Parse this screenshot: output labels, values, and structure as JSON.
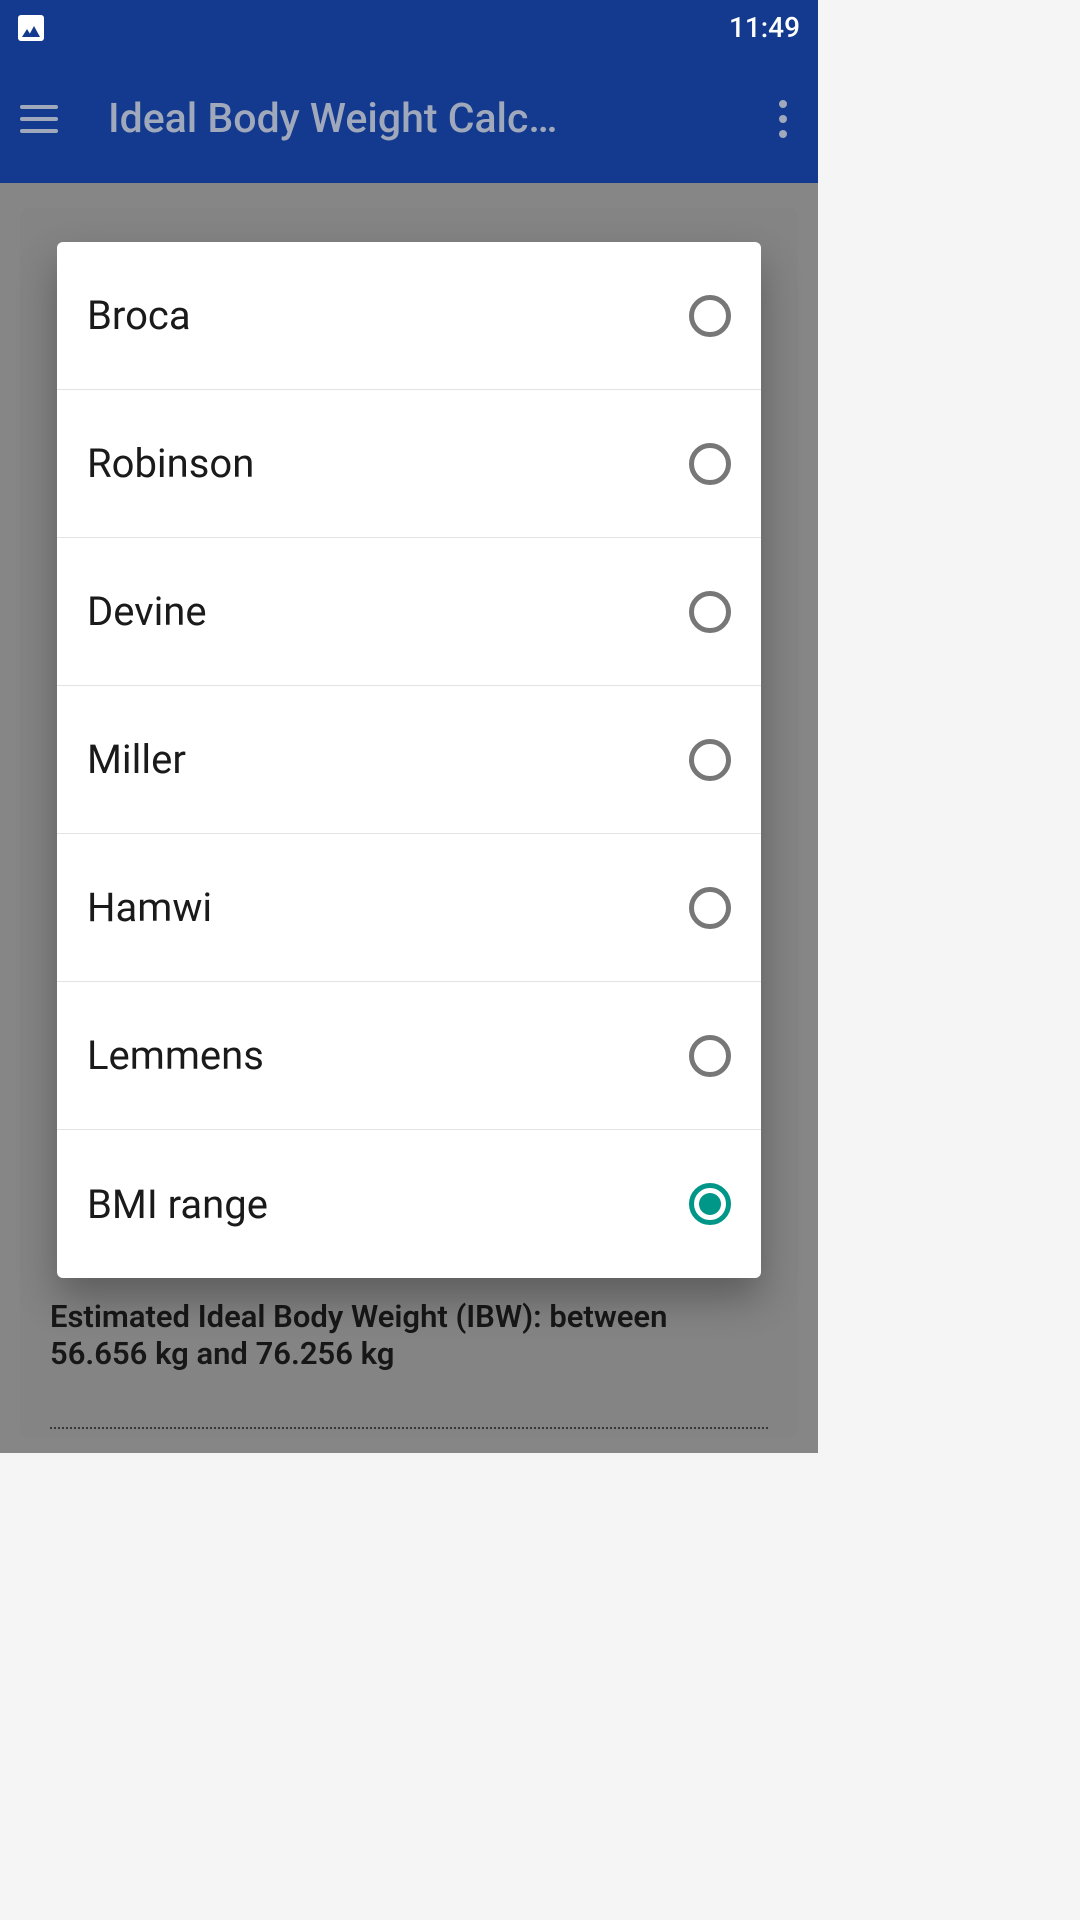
{
  "status_bar": {
    "time": "11:49"
  },
  "app_bar": {
    "title": "Ideal Body Weight Calc…"
  },
  "background": {
    "result_text": "Estimated Ideal Body Weight (IBW): between 56.656 kg and 76.256 kg"
  },
  "dialog": {
    "options": [
      {
        "label": "Broca",
        "selected": false
      },
      {
        "label": "Robinson",
        "selected": false
      },
      {
        "label": "Devine",
        "selected": false
      },
      {
        "label": "Miller",
        "selected": false
      },
      {
        "label": "Hamwi",
        "selected": false
      },
      {
        "label": "Lemmens",
        "selected": false
      },
      {
        "label": "BMI range",
        "selected": true
      }
    ]
  }
}
